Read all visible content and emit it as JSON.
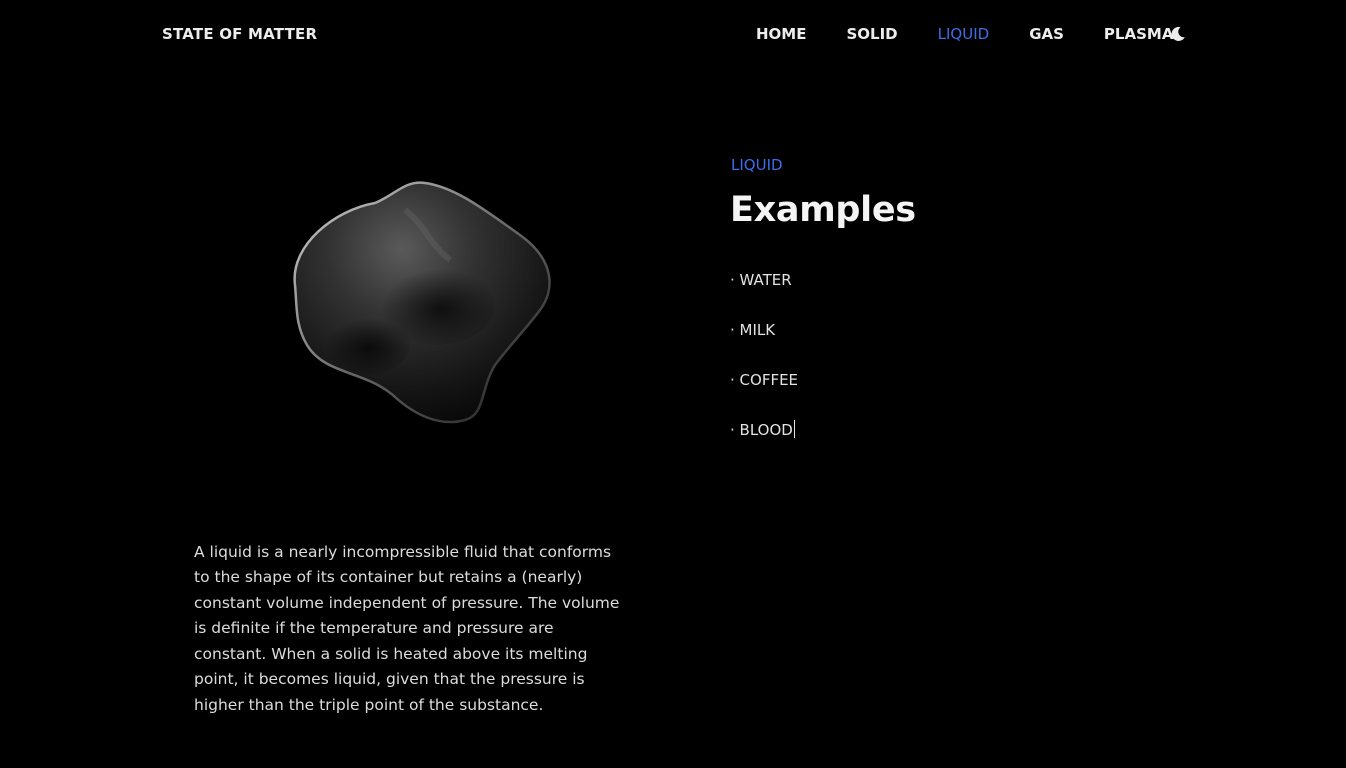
{
  "brand": "STATE OF MATTER",
  "nav": {
    "items": [
      "HOME",
      "SOLID",
      "LIQUID",
      "GAS",
      "PLASMA"
    ],
    "active": "LIQUID",
    "theme_toggle_icon": "moon-icon"
  },
  "colors": {
    "accent": "#3d6ee8",
    "background": "#000000"
  },
  "hero_image_icon": "liquid-blob-icon",
  "description": "A liquid is a nearly incompressible fluid that conforms to the shape of its container but retains a (nearly) constant volume independent of pressure. The volume is definite if the temperature and pressure are constant. When a solid is heated above its melting point, it becomes liquid, given that the pressure is higher than the triple point of the substance.",
  "section": {
    "kicker": "LIQUID",
    "title": "Examples",
    "examples": [
      "· WATER",
      "· MILK",
      "· COFFEE",
      "· BLOOD"
    ]
  }
}
